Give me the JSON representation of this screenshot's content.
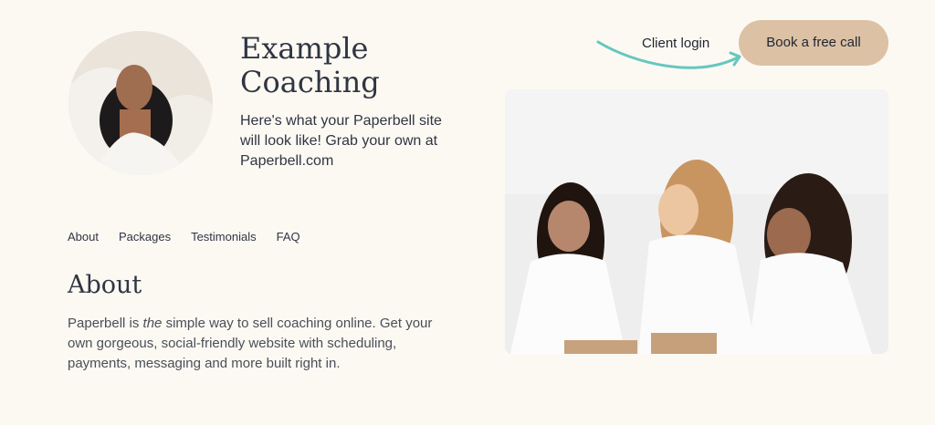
{
  "brand": {
    "title": "Example Coaching",
    "tagline": "Here's what your Paperbell site will look like! Grab your own at Paperbell.com"
  },
  "header": {
    "client_login": "Client login",
    "cta": "Book a free call"
  },
  "nav": {
    "items": [
      "About",
      "Packages",
      "Testimonials",
      "FAQ"
    ]
  },
  "about": {
    "heading": "About",
    "text_before": "Paperbell is ",
    "text_emphasis": "the",
    "text_after": " simple way to sell coaching online. Get your own gorgeous, social-friendly website with scheduling, payments, messaging and more built right in."
  },
  "colors": {
    "background": "#fcf9f3",
    "cta": "#dcc1a5",
    "arrow": "#66c7c0"
  },
  "icons": {
    "arrow": "curved-arrow-icon"
  }
}
